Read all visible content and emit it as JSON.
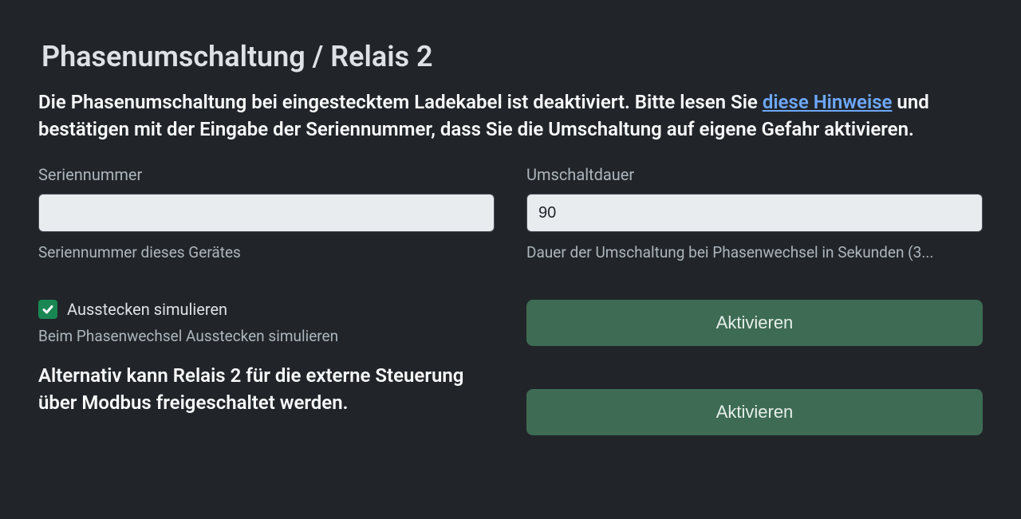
{
  "title": "Phasenumschaltung / Relais 2",
  "description": {
    "before_link": "Die Phasenumschaltung bei eingestecktem Ladekabel ist deaktiviert. Bitte lesen Sie ",
    "link_text": "diese Hinweise",
    "after_link": " und bestätigen mit der Eingabe der Seriennummer, dass Sie die Umschaltung auf eigene Gefahr aktivieren."
  },
  "serial": {
    "label": "Seriennummer",
    "value": "",
    "help": "Seriennummer dieses Gerätes"
  },
  "duration": {
    "label": "Umschaltdauer",
    "value": "90",
    "help": "Dauer der Umschaltung bei Phasenwechsel in Sekunden (3..."
  },
  "simulate": {
    "label": "Ausstecken simulieren",
    "checked": true,
    "help": "Beim Phasenwechsel Ausstecken simulieren"
  },
  "alt_text": "Alternativ kann Relais 2 für die externe Steuerung über Modbus freigeschaltet werden.",
  "buttons": {
    "activate1": "Aktivieren",
    "activate2": "Aktivieren"
  }
}
